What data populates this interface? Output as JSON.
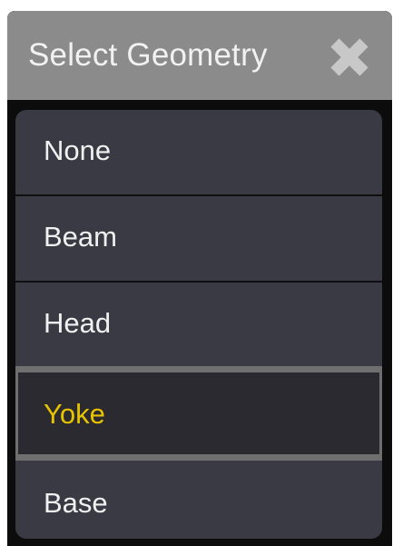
{
  "dialog": {
    "title": "Select Geometry",
    "close_icon": "close-x-icon"
  },
  "list": {
    "items": [
      {
        "label": "None",
        "selected": false
      },
      {
        "label": "Beam",
        "selected": false
      },
      {
        "label": "Head",
        "selected": false
      },
      {
        "label": "Yoke",
        "selected": true
      },
      {
        "label": "Base",
        "selected": false
      }
    ]
  },
  "colors": {
    "titlebar": "#8b8b8b",
    "list_bg": "#3a3a44",
    "selected_text": "#e8c400",
    "selected_border": "#6f6f6f",
    "text": "#f0f0f0"
  }
}
